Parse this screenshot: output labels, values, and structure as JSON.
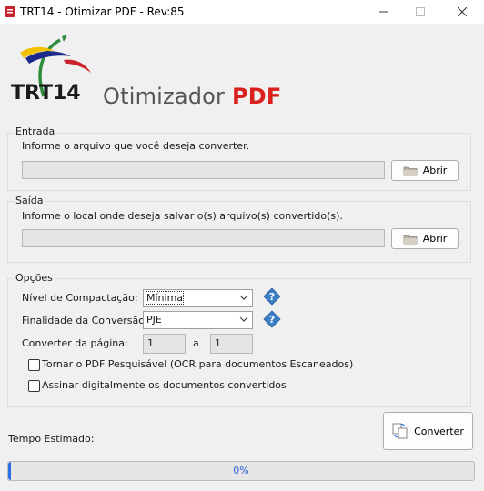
{
  "window": {
    "title": "TRT14 - Otimizar PDF - Rev:85"
  },
  "header": {
    "logo_text": "TRT14",
    "title_main": "Otimizador ",
    "title_accent": "PDF"
  },
  "entrada": {
    "legend": "Entrada",
    "instruction": "Informe o arquivo que você deseja converter.",
    "path_value": "",
    "button_label": "Abrir"
  },
  "saida": {
    "legend": "Saída",
    "instruction": "Informe o local onde deseja salvar o(s) arquivo(s) convertido(s).",
    "path_value": "",
    "button_label": "Abrir"
  },
  "opcoes": {
    "legend": "Opções",
    "compactacao_label": "Nível de Compactação:",
    "compactacao_value": "Mínima",
    "finalidade_label": "Finalidade da Conversão:",
    "finalidade_value": "PJE",
    "pagina_label": "Converter da página:",
    "pagina_de": "1",
    "pagina_sep": "a",
    "pagina_ate": "1",
    "ocr_label": "Tornar o PDF Pesquisável (OCR para documentos Escaneados)",
    "ocr_checked": false,
    "assinar_label": "Assinar digitalmente os documentos convertidos",
    "assinar_checked": false
  },
  "footer": {
    "tempo_label": "Tempo Estimado:",
    "tempo_value": "",
    "converter_label": "Converter",
    "progress_percent": 0,
    "progress_text": "0%"
  },
  "colors": {
    "accent_red": "#d9201c",
    "progress_blue": "#2a6ee6",
    "help_blue": "#3b7fc4"
  }
}
